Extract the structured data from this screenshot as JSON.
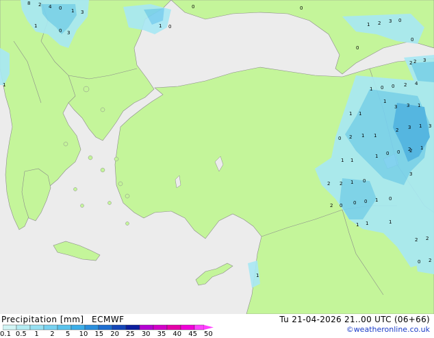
{
  "title": "Precipitation [mm]",
  "model": "ECMWF",
  "valid_time": "Tu 21-04-2026 21..00 UTC (06+66)",
  "credit": "©weatheronline.co.uk",
  "legend": {
    "ticks": [
      "0.1",
      "0.5",
      "1",
      "2",
      "5",
      "10",
      "15",
      "20",
      "25",
      "30",
      "35",
      "40",
      "45",
      "50"
    ],
    "colors": [
      "#d2f5f5",
      "#b4ecf3",
      "#96e0f2",
      "#78d2f0",
      "#5ac3ec",
      "#3caee8",
      "#2a8fdc",
      "#1e6ed0",
      "#1446b8",
      "#0c1e9e",
      "#b400d2",
      "#d200c8",
      "#e400a8",
      "#f000d8",
      "#ff40ff"
    ]
  },
  "colors": {
    "sea": "#ececec",
    "land": "#c4f59a",
    "border": "#8a8a8a",
    "precip_light": "#a8e8f4",
    "precip_mid": "#78d0f0",
    "precip_heavy": "#4ab0e8"
  },
  "map_values": [
    {
      "text": "8"
    },
    {
      "text": "2"
    },
    {
      "text": "4"
    },
    {
      "text": "0"
    },
    {
      "text": "1"
    },
    {
      "text": "3"
    },
    {
      "text": "1"
    },
    {
      "text": "0"
    },
    {
      "text": "3"
    },
    {
      "text": "1"
    },
    {
      "text": "0"
    },
    {
      "text": "0"
    },
    {
      "text": "0"
    },
    {
      "text": "1"
    },
    {
      "text": "2"
    },
    {
      "text": "3"
    },
    {
      "text": "0"
    },
    {
      "text": "0"
    },
    {
      "text": "0"
    },
    {
      "text": "2"
    },
    {
      "text": "3"
    },
    {
      "text": "1"
    },
    {
      "text": "0"
    },
    {
      "text": "0"
    },
    {
      "text": "2"
    },
    {
      "text": "4"
    },
    {
      "text": "1"
    },
    {
      "text": "3"
    },
    {
      "text": "3"
    },
    {
      "text": "1"
    },
    {
      "text": "1"
    },
    {
      "text": "1"
    },
    {
      "text": "2"
    },
    {
      "text": "3"
    },
    {
      "text": "1"
    },
    {
      "text": "3"
    },
    {
      "text": "0"
    },
    {
      "text": "2"
    },
    {
      "text": "1"
    },
    {
      "text": "1"
    },
    {
      "text": "2"
    },
    {
      "text": "1"
    },
    {
      "text": "1"
    },
    {
      "text": "0"
    },
    {
      "text": "0"
    },
    {
      "text": "2"
    },
    {
      "text": "1"
    },
    {
      "text": "1"
    },
    {
      "text": "2"
    },
    {
      "text": "0"
    },
    {
      "text": "3"
    },
    {
      "text": "2"
    },
    {
      "text": "1"
    },
    {
      "text": "2"
    },
    {
      "text": "0"
    },
    {
      "text": "0"
    },
    {
      "text": "0"
    },
    {
      "text": "1"
    },
    {
      "text": "0"
    },
    {
      "text": "1"
    },
    {
      "text": "1"
    },
    {
      "text": "1"
    },
    {
      "text": "2"
    },
    {
      "text": "2"
    },
    {
      "text": "2"
    },
    {
      "text": "1"
    },
    {
      "text": "0"
    },
    {
      "text": "2"
    },
    {
      "text": "1"
    }
  ]
}
